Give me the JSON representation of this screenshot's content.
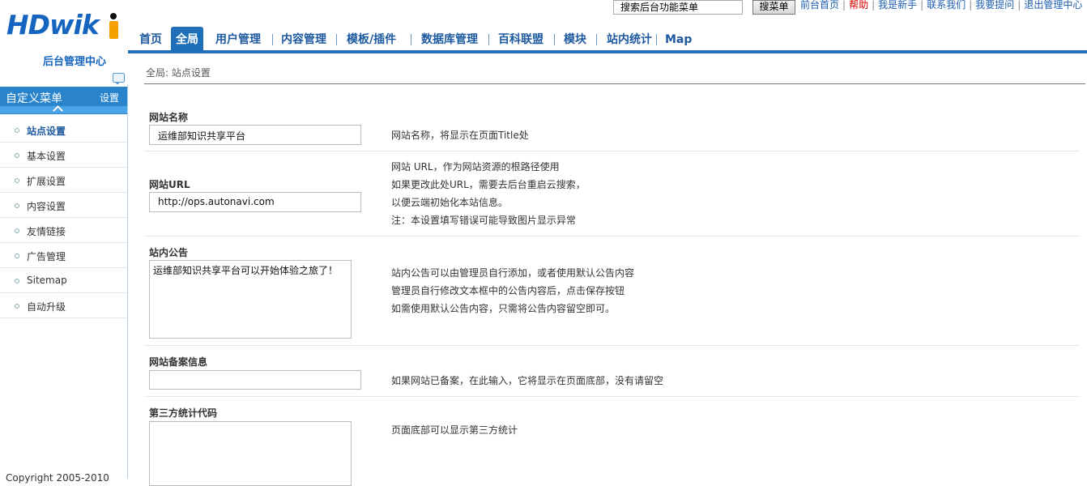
{
  "logo": {
    "text": "HDwik",
    "subtitle": "后台管理中心"
  },
  "top": {
    "search_value": "搜索后台功能菜单",
    "search_button": "搜菜单",
    "links": [
      "前台首页",
      "帮助",
      "我是新手",
      "联系我们",
      "我要提问",
      "退出管理中心"
    ]
  },
  "nav": {
    "items": [
      "首页",
      "全局",
      "用户管理",
      "内容管理",
      "模板/插件",
      "数据库管理",
      "百科联盟",
      "模块",
      "站内统计",
      "Map"
    ],
    "active": "全局"
  },
  "sidebar": {
    "menu_title": "自定义菜单",
    "menu_setting": "设置",
    "items": [
      {
        "label": "站点设置"
      },
      {
        "label": "基本设置"
      },
      {
        "label": "扩展设置"
      },
      {
        "label": "内容设置"
      },
      {
        "label": "友情链接"
      },
      {
        "label": "广告管理"
      },
      {
        "label": "Sitemap"
      },
      {
        "label": "自动升级"
      }
    ],
    "copyright": "Copyright 2005-2010"
  },
  "main": {
    "breadcrumb": "全局: 站点设置",
    "site_name": {
      "label": "网站名称",
      "value": "运维部知识共享平台",
      "desc": "网站名称，将显示在页面Title处"
    },
    "site_url": {
      "label": "网站URL",
      "value": "http://ops.autonavi.com",
      "desc": [
        "网站 URL，作为网站资源的根路径使用",
        "如果更改此处URL，需要去后台重启云搜索，",
        "以便云端初始化本站信息。",
        "注：本设置填写错误可能导致图片显示异常"
      ]
    },
    "notice": {
      "label": "站内公告",
      "value": "运维部知识共享平台可以开始体验之旅了！",
      "desc": [
        "站内公告可以由管理员自行添加，或者使用默认公告内容",
        "管理员自行修改文本框中的公告内容后，点击保存按钮",
        "如需使用默认公告内容，只需将公告内容留空即可。"
      ]
    },
    "icp": {
      "label": "网站备案信息",
      "value": "",
      "desc": "如果网站已备案，在此输入，它将显示在页面底部，没有请留空"
    },
    "stats": {
      "label": "第三方统计代码",
      "value": "",
      "desc": "页面底部可以显示第三方统计"
    }
  }
}
